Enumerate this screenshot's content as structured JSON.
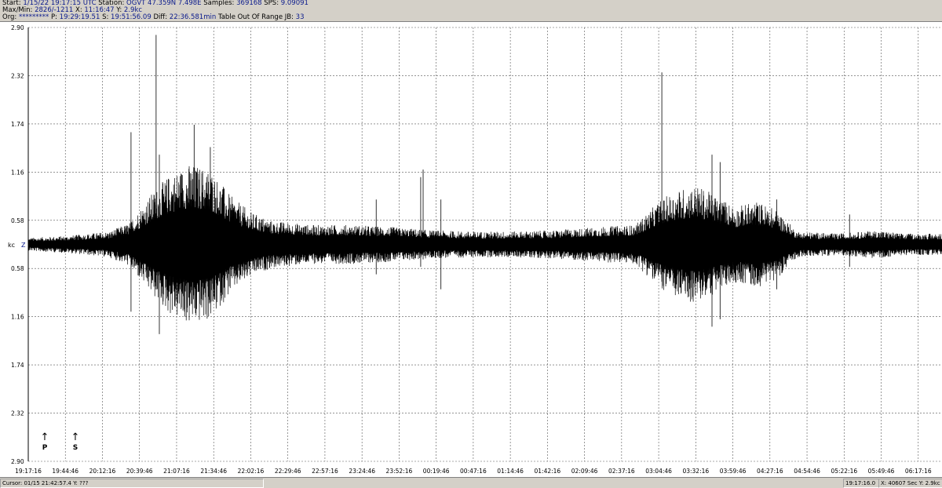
{
  "header": {
    "line1": {
      "start_label": "Start:",
      "start": "1/15/22 19:17:15 UTC",
      "station_label": "Station:",
      "station": "OGVT 47.359N 7.498E",
      "samples_label": "Samples:",
      "samples": "369168",
      "sps_label": "SPS:",
      "sps": "9.09091"
    },
    "line2": {
      "maxmin_label": "Max/Min:",
      "maxmin": "2826/-1211",
      "x_label": "X:",
      "x": "11:16:47",
      "y_label": "Y:",
      "y": "2.9kc"
    },
    "line3": {
      "org_label": "Org:",
      "org": "*********",
      "p_label": "P:",
      "p": "19:29:19.51",
      "s_label": "S:",
      "s": "19:51:56.09",
      "diff_label": "Diff:",
      "diff": "22:36.581min",
      "table": "Table Out Of Range",
      "jb_label": "JB:",
      "jb": "33"
    }
  },
  "channel": {
    "unit": "kc",
    "component": "Z"
  },
  "markers": [
    {
      "label": "P",
      "symbol": "↑"
    },
    {
      "label": "S",
      "symbol": "↑"
    }
  ],
  "status": {
    "cursor": "Cursor: 01/15 21:42:57.4  Y: ???",
    "time": "19:17:16.0",
    "info": "X: 40607 Sec Y: 2.9kc"
  },
  "chart_data": {
    "type": "line",
    "title": "",
    "ylabel": "kc",
    "ylim": [
      -2.9,
      2.9
    ],
    "y_tick_labels": [
      "2.90",
      "2.32",
      "1.74",
      "1.16",
      "0.58",
      "0.58",
      "1.16",
      "1.74",
      "2.32",
      "2.90"
    ],
    "x_tick_labels": [
      "19:17:16",
      "19:44:46",
      "20:12:16",
      "20:39:46",
      "21:07:16",
      "21:34:46",
      "22:02:16",
      "22:29:46",
      "22:57:16",
      "23:24:46",
      "23:52:16",
      "00:19:46",
      "00:47:16",
      "01:14:46",
      "01:42:16",
      "02:09:46",
      "02:37:16",
      "03:04:46",
      "03:32:16",
      "03:59:46",
      "04:27:16",
      "04:54:46",
      "05:22:16",
      "05:49:46",
      "06:17:16"
    ],
    "grid": true,
    "series": [
      {
        "envelope_time_hours": [
          0.0,
          0.5,
          1.0,
          1.25,
          1.5,
          1.75,
          2.0,
          2.25,
          2.5,
          2.75,
          3.0,
          3.5,
          4.0,
          4.5,
          5.0,
          5.5,
          6.0,
          6.5,
          7.0,
          7.5,
          7.8,
          8.0,
          8.25,
          8.5,
          8.75,
          9.0,
          9.25,
          9.5,
          10.0,
          10.5,
          10.8,
          11.0,
          11.5,
          11.83
        ],
        "envelope_amplitude_kc": [
          0.06,
          0.08,
          0.12,
          0.2,
          0.45,
          0.65,
          0.75,
          0.7,
          0.45,
          0.3,
          0.22,
          0.18,
          0.18,
          0.16,
          0.13,
          0.12,
          0.12,
          0.13,
          0.16,
          0.18,
          0.4,
          0.5,
          0.55,
          0.45,
          0.35,
          0.4,
          0.32,
          0.12,
          0.1,
          0.13,
          0.1,
          0.1,
          0.1,
          0.1
        ]
      }
    ],
    "spikes": [
      {
        "time_hours": 1.27,
        "peak_kc": 1.5,
        "trough_kc": -0.9
      },
      {
        "time_hours": 1.58,
        "peak_kc": 2.8,
        "trough_kc": -0.6
      },
      {
        "time_hours": 1.62,
        "peak_kc": 1.2,
        "trough_kc": -1.2
      },
      {
        "time_hours": 2.05,
        "peak_kc": 1.6,
        "trough_kc": -0.5
      },
      {
        "time_hours": 2.25,
        "peak_kc": 1.3,
        "trough_kc": -0.3
      },
      {
        "time_hours": 4.3,
        "peak_kc": 0.6,
        "trough_kc": -0.4
      },
      {
        "time_hours": 4.85,
        "peak_kc": 0.9,
        "trough_kc": -0.3
      },
      {
        "time_hours": 4.88,
        "peak_kc": 1.0,
        "trough_kc": -0.2
      },
      {
        "time_hours": 5.1,
        "peak_kc": 0.6,
        "trough_kc": -0.6
      },
      {
        "time_hours": 7.83,
        "peak_kc": 2.3,
        "trough_kc": -0.5
      },
      {
        "time_hours": 8.45,
        "peak_kc": 1.2,
        "trough_kc": -1.1
      },
      {
        "time_hours": 8.55,
        "peak_kc": 1.1,
        "trough_kc": -1.0
      },
      {
        "time_hours": 9.25,
        "peak_kc": 0.6,
        "trough_kc": -0.6
      },
      {
        "time_hours": 10.15,
        "peak_kc": 0.4,
        "trough_kc": -0.3
      }
    ]
  }
}
